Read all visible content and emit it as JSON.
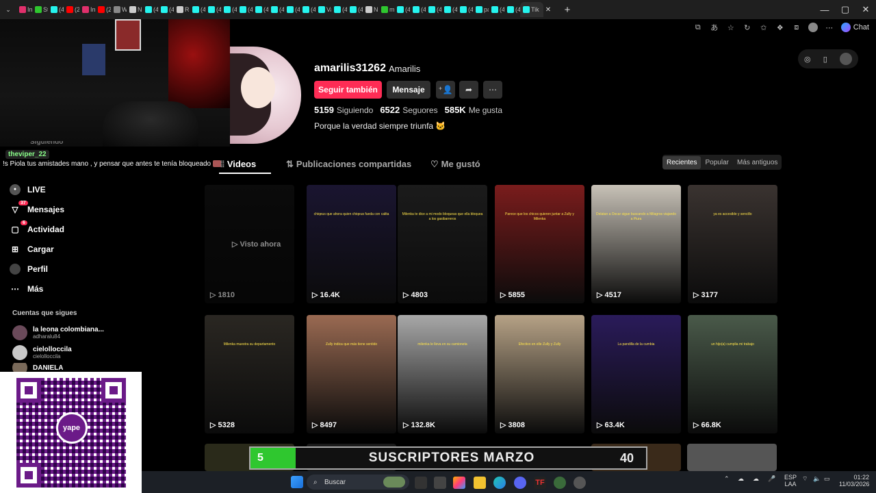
{
  "browser": {
    "tabs": [
      {
        "label": "Inst",
        "color": "#e1306c"
      },
      {
        "label": "St",
        "color": "#2fc72f"
      },
      {
        "label": "(4",
        "color": "#25f4ee"
      },
      {
        "label": "(2",
        "color": "#ff0000"
      },
      {
        "label": "Ins",
        "color": "#e1306c"
      },
      {
        "label": "(2",
        "color": "#ff0000"
      },
      {
        "label": "W",
        "color": "#888"
      },
      {
        "label": "Nu",
        "color": "#ccc"
      },
      {
        "label": "(4",
        "color": "#25f4ee"
      },
      {
        "label": "(4",
        "color": "#25f4ee"
      },
      {
        "label": "Re",
        "color": "#ccc"
      },
      {
        "label": "(4",
        "color": "#25f4ee"
      },
      {
        "label": "(4",
        "color": "#25f4ee"
      },
      {
        "label": "(4",
        "color": "#25f4ee"
      },
      {
        "label": "(4",
        "color": "#25f4ee"
      },
      {
        "label": "(4",
        "color": "#25f4ee"
      },
      {
        "label": "(4",
        "color": "#25f4ee"
      },
      {
        "label": "(4",
        "color": "#25f4ee"
      },
      {
        "label": "(4",
        "color": "#25f4ee"
      },
      {
        "label": "Va",
        "color": "#25f4ee"
      },
      {
        "label": "(4",
        "color": "#25f4ee"
      },
      {
        "label": "(4",
        "color": "#25f4ee"
      },
      {
        "label": "Nu",
        "color": "#ccc"
      },
      {
        "label": "m",
        "color": "#2fc72f"
      },
      {
        "label": "(4",
        "color": "#25f4ee"
      },
      {
        "label": "(4",
        "color": "#25f4ee"
      },
      {
        "label": "(4",
        "color": "#25f4ee"
      },
      {
        "label": "(4",
        "color": "#25f4ee"
      },
      {
        "label": "(4",
        "color": "#25f4ee"
      },
      {
        "label": "pa",
        "color": "#25f4ee"
      },
      {
        "label": "(4",
        "color": "#25f4ee"
      },
      {
        "label": "(4",
        "color": "#25f4ee"
      },
      {
        "label": "Tik",
        "color": "#25f4ee"
      }
    ],
    "active_tab": "Tik",
    "new_tab": "+",
    "close_tab": "✕",
    "chat_label": "Chat"
  },
  "stream": {
    "chat_user": "theviper_22",
    "chat_message": "!s Piola tus amistades mano , y pensar que antes te tenía bloqueado",
    "partial_item": "Siguiendo"
  },
  "profile": {
    "username": "amarilis31262",
    "nickname": "Amarilis",
    "follow_button": "Seguir también",
    "message_button": "Mensaje",
    "following_count": "5159",
    "following_label": "Siguiendo",
    "followers_count": "6522",
    "followers_label": "Seguores",
    "likes_count": "585K",
    "likes_label": "Me gusta",
    "bio": "Porque la verdad siempre triunfa 🐱"
  },
  "content_tabs": {
    "videos": "Videos",
    "shared": "Publicaciones compartidas",
    "liked": "Me gustó"
  },
  "sort": {
    "options": [
      "Recientes",
      "Popular",
      "Más antiguos"
    ],
    "selected": "Recientes"
  },
  "sidebar": {
    "items": [
      {
        "label": "LIVE",
        "icon": "live-icon",
        "badge": ""
      },
      {
        "label": "Mensajes",
        "icon": "messages-icon",
        "badge": "37"
      },
      {
        "label": "Actividad",
        "icon": "activity-icon",
        "badge": "6"
      },
      {
        "label": "Cargar",
        "icon": "upload-icon",
        "badge": ""
      },
      {
        "label": "Perfil",
        "icon": "profile-icon",
        "badge": ""
      },
      {
        "label": "Más",
        "icon": "more-icon",
        "badge": ""
      }
    ],
    "following_header": "Cuentas que sigues",
    "following": [
      {
        "name": "la leona colombiana...",
        "handle": "adharalu84"
      },
      {
        "name": "cielolloccila",
        "handle": "cielolloccila"
      },
      {
        "name": "DANIELA",
        "handle": ""
      }
    ]
  },
  "qr": {
    "brand": "yape"
  },
  "videos": [
    {
      "views": "1810",
      "watched": "Visto ahora",
      "bg": "#141414",
      "text": ""
    },
    {
      "views": "16.4K",
      "watched": "",
      "bg": "#1a1530",
      "text": "chiqeus que ahora quien chiqeus fueda con calita"
    },
    {
      "views": "4803",
      "watched": "",
      "bg": "#1b1b1b",
      "text": "Milenka te dice a mi modo bloqueas que ella bloquea a los gasibarreros"
    },
    {
      "views": "5855",
      "watched": "",
      "bg": "#7a1c1c",
      "text": "Parece que los chicos quieren juntar a Zully y Milenka"
    },
    {
      "views": "4517",
      "watched": "",
      "bg": "#c8c2b8",
      "text": "Delatan a Oscar sigue buscando a Milagros viajando a Piura"
    },
    {
      "views": "3177",
      "watched": "",
      "bg": "#3a3330",
      "text": "ya es accesible y sencillo"
    },
    {
      "views": "5328",
      "watched": "",
      "bg": "#2a2722",
      "text": "Milenka muestra su departamento"
    },
    {
      "views": "8497",
      "watched": "",
      "bg": "#9a6a52",
      "text": "Zully indica que más tiene sentido"
    },
    {
      "views": "132.8K",
      "watched": "",
      "bg": "#a8a8a8",
      "text": "milenka le lleva en su camioneta"
    },
    {
      "views": "3808",
      "watched": "",
      "bg": "#b6a286",
      "text": "Efectivo en elle Zully y Zully"
    },
    {
      "views": "63.4K",
      "watched": "",
      "bg": "#2a1b5a",
      "text": "La pandilla de la cumbia"
    },
    {
      "views": "66.8K",
      "watched": "",
      "bg": "#4a5a4a",
      "text": "un hijo(a) cumplia mi trabajo"
    }
  ],
  "banner": {
    "left_number": "5",
    "title": "SUSCRIPTORES MARZO",
    "right_number": "40"
  },
  "taskbar": {
    "search_placeholder": "Buscar",
    "lang": "ESP",
    "lang2": "LAA",
    "time": "01:22",
    "date": "11/03/2026"
  }
}
